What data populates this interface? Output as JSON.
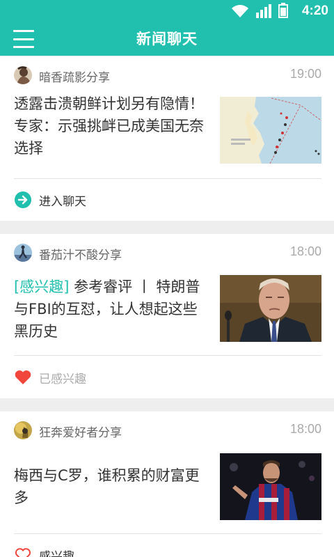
{
  "status_bar": {
    "time": "4:20"
  },
  "header": {
    "title": "新闻聊天"
  },
  "cards": [
    {
      "source": "暗香疏影分享",
      "time": "19:00",
      "tag": "",
      "title": "透露击溃朝鲜计划另有隐情！专家：示强挑衅已成美国无奈选择",
      "action": "进入聊天",
      "action_icon": "arrow-right-circle-icon"
    },
    {
      "source": "番茄汁不酸分享",
      "time": "18:00",
      "tag": "[感兴趣]",
      "title": " 参考睿评 丨 特朗普与FBI的互怼，让人想起这些黑历史",
      "action": "已感兴趣",
      "action_icon": "heart-filled-icon"
    },
    {
      "source": "狂奔爱好者分享",
      "time": "18:00",
      "tag": "",
      "title": "梅西与C罗，谁积累的财富更多",
      "action": "感兴趣",
      "action_icon": "heart-outline-icon"
    }
  ],
  "colors": {
    "accent": "#21bfae",
    "liked": "#f0463c",
    "card_bg": "#ffffff",
    "page_bg": "#eeeeee"
  }
}
